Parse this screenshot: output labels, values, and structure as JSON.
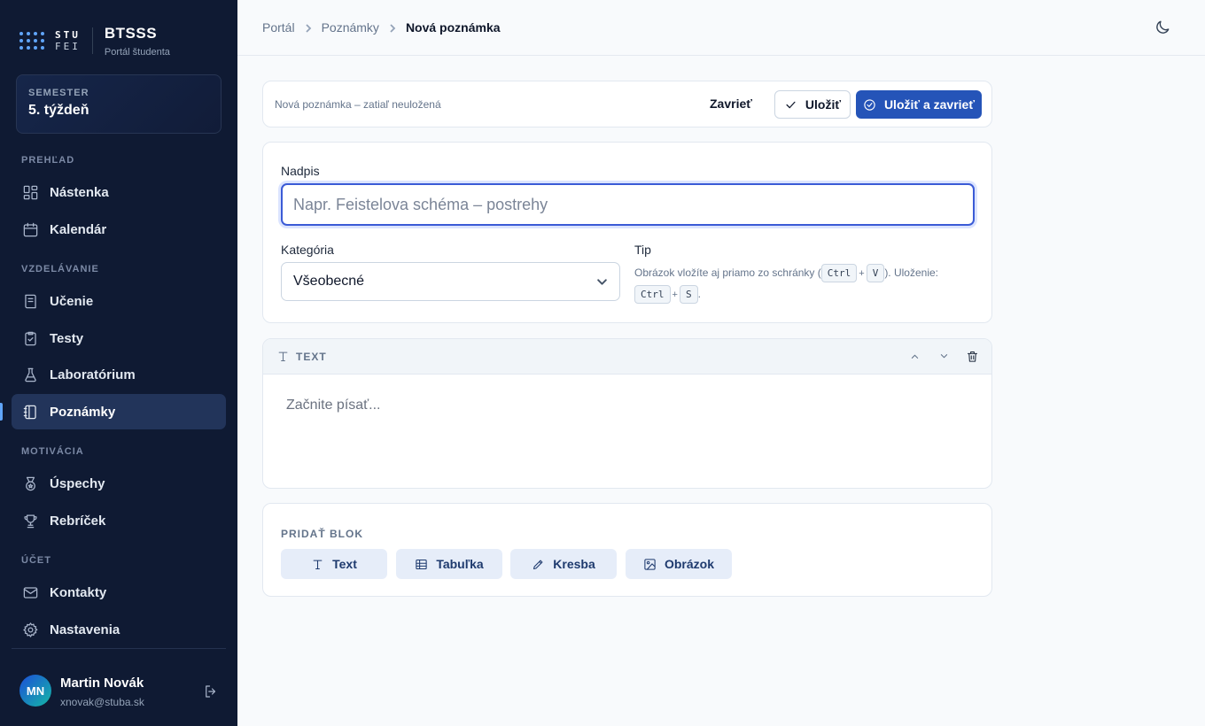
{
  "app": {
    "logo_top": "STU",
    "logo_bottom": "FEI",
    "name": "BTSSS",
    "subtitle": "Portál študenta"
  },
  "semester": {
    "label": "SEMESTER",
    "value": "5. týždeň"
  },
  "nav": {
    "sections": {
      "overview": "PREHĽAD",
      "education": "VZDELÁVANIE",
      "motivation": "MOTIVÁCIA",
      "account": "ÚČET"
    },
    "items": {
      "dashboard": "Nástenka",
      "calendar": "Kalendár",
      "learning": "Učenie",
      "tests": "Testy",
      "laboratory": "Laboratórium",
      "notes": "Poznámky",
      "achievements": "Úspechy",
      "leaderboard": "Rebríček",
      "contacts": "Kontakty",
      "settings": "Nastavenia"
    },
    "active": "notes"
  },
  "user": {
    "initials": "MN",
    "name": "Martin Novák",
    "email": "xnovak@stuba.sk"
  },
  "breadcrumb": {
    "root": "Portál",
    "parent": "Poznámky",
    "current": "Nová poznámka"
  },
  "toolbar": {
    "status": "Nová poznámka – zatiaľ neuložená",
    "close_label": "Zavrieť",
    "save_label": "Uložiť",
    "save_close_label": "Uložiť a zavrieť"
  },
  "form": {
    "title_label": "Nadpis",
    "title_placeholder": "Napr. Feistelova schéma – postrehy",
    "title_value": "",
    "category_label": "Kategória",
    "category_value": "Všeobecné",
    "tip_label": "Tip",
    "tip_text_1": "Obrázok vložíte aj priamo zo schránky (",
    "tip_key_ctrl": "Ctrl",
    "tip_plus": "+",
    "tip_key_v": "V",
    "tip_text_2": "). Uloženie:",
    "tip_key_s": "S",
    "tip_text_3": "."
  },
  "block": {
    "type_label": "TEXT",
    "placeholder": "Začnite písať..."
  },
  "add_block": {
    "title": "PRIDAŤ BLOK",
    "buttons": {
      "text": "Text",
      "table": "Tabuľka",
      "drawing": "Kresba",
      "image": "Obrázok"
    }
  },
  "colors": {
    "sidebar_bg": "#0f1a33",
    "accent": "#2554b8",
    "focus_ring": "#3b5bd6"
  }
}
